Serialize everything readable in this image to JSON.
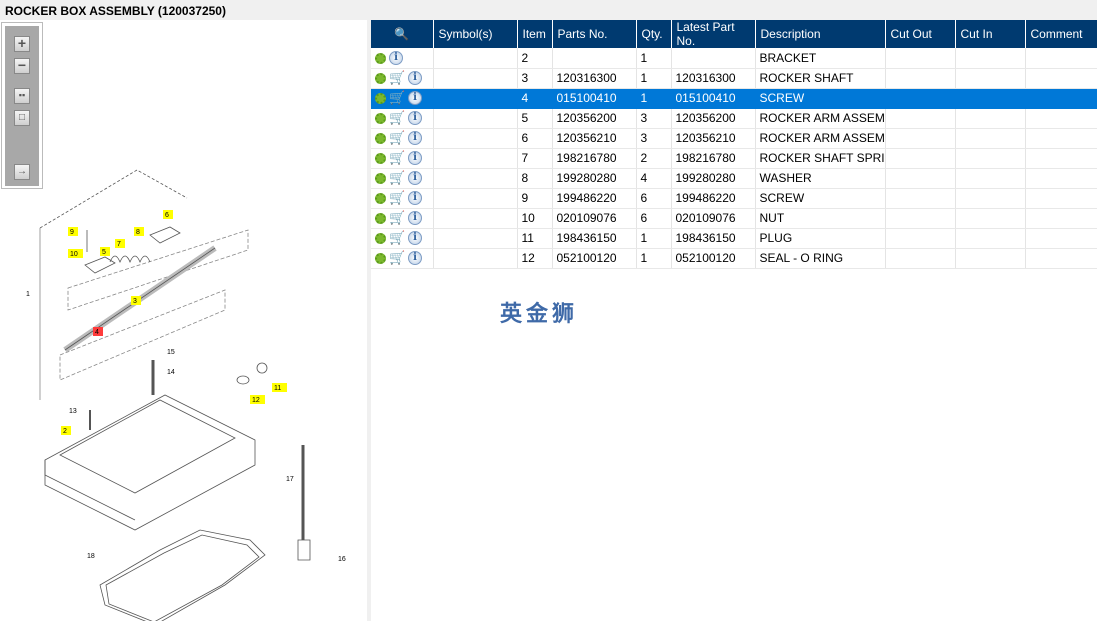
{
  "title": "ROCKER BOX ASSEMBLY (120037250)",
  "toolbar": {
    "zoom_in": "zoom-in",
    "zoom_out": "zoom-out",
    "fit": "fit",
    "reset": "reset",
    "export": "export"
  },
  "columns": [
    "",
    "Symbol(s)",
    "Item",
    "Parts No.",
    "Qty.",
    "Latest Part No.",
    "Description",
    "Cut Out",
    "Cut In",
    "Comment"
  ],
  "rows": [
    {
      "item": "2",
      "part": "",
      "qty": "1",
      "latest": "",
      "desc": "BRACKET",
      "cart": false
    },
    {
      "item": "3",
      "part": "120316300",
      "qty": "1",
      "latest": "120316300",
      "desc": "ROCKER SHAFT",
      "cart": true
    },
    {
      "item": "4",
      "part": "015100410",
      "qty": "1",
      "latest": "015100410",
      "desc": "SCREW",
      "cart": true,
      "selected": true
    },
    {
      "item": "5",
      "part": "120356200",
      "qty": "3",
      "latest": "120356200",
      "desc": "ROCKER ARM ASSEMBLY",
      "cart": true
    },
    {
      "item": "6",
      "part": "120356210",
      "qty": "3",
      "latest": "120356210",
      "desc": "ROCKER ARM ASSEMBLY",
      "cart": true
    },
    {
      "item": "7",
      "part": "198216780",
      "qty": "2",
      "latest": "198216780",
      "desc": "ROCKER SHAFT SPRING",
      "cart": true
    },
    {
      "item": "8",
      "part": "199280280",
      "qty": "4",
      "latest": "199280280",
      "desc": "WASHER",
      "cart": true
    },
    {
      "item": "9",
      "part": "199486220",
      "qty": "6",
      "latest": "199486220",
      "desc": "SCREW",
      "cart": true
    },
    {
      "item": "10",
      "part": "020109076",
      "qty": "6",
      "latest": "020109076",
      "desc": "NUT",
      "cart": true
    },
    {
      "item": "11",
      "part": "198436150",
      "qty": "1",
      "latest": "198436150",
      "desc": "PLUG",
      "cart": true
    },
    {
      "item": "12",
      "part": "052100120",
      "qty": "1",
      "latest": "052100120",
      "desc": "SEAL - O RING",
      "cart": true
    }
  ],
  "diagram_labels": [
    {
      "t": "9",
      "hl": "y"
    },
    {
      "t": "10",
      "hl": "y"
    },
    {
      "t": "5",
      "hl": "y"
    },
    {
      "t": "7",
      "hl": "y"
    },
    {
      "t": "8",
      "hl": "y"
    },
    {
      "t": "6",
      "hl": "y"
    },
    {
      "t": "1",
      "hl": ""
    },
    {
      "t": "3",
      "hl": "y"
    },
    {
      "t": "4",
      "hl": "r"
    },
    {
      "t": "15",
      "hl": ""
    },
    {
      "t": "14",
      "hl": ""
    },
    {
      "t": "12",
      "hl": "y"
    },
    {
      "t": "11",
      "hl": "y"
    },
    {
      "t": "13",
      "hl": ""
    },
    {
      "t": "2",
      "hl": "y"
    },
    {
      "t": "17",
      "hl": ""
    },
    {
      "t": "18",
      "hl": ""
    },
    {
      "t": "16",
      "hl": ""
    }
  ],
  "watermark": "英金狮",
  "colors": {
    "header": "#003a70",
    "selected": "#0078d7",
    "highlight": "#ffff00"
  }
}
